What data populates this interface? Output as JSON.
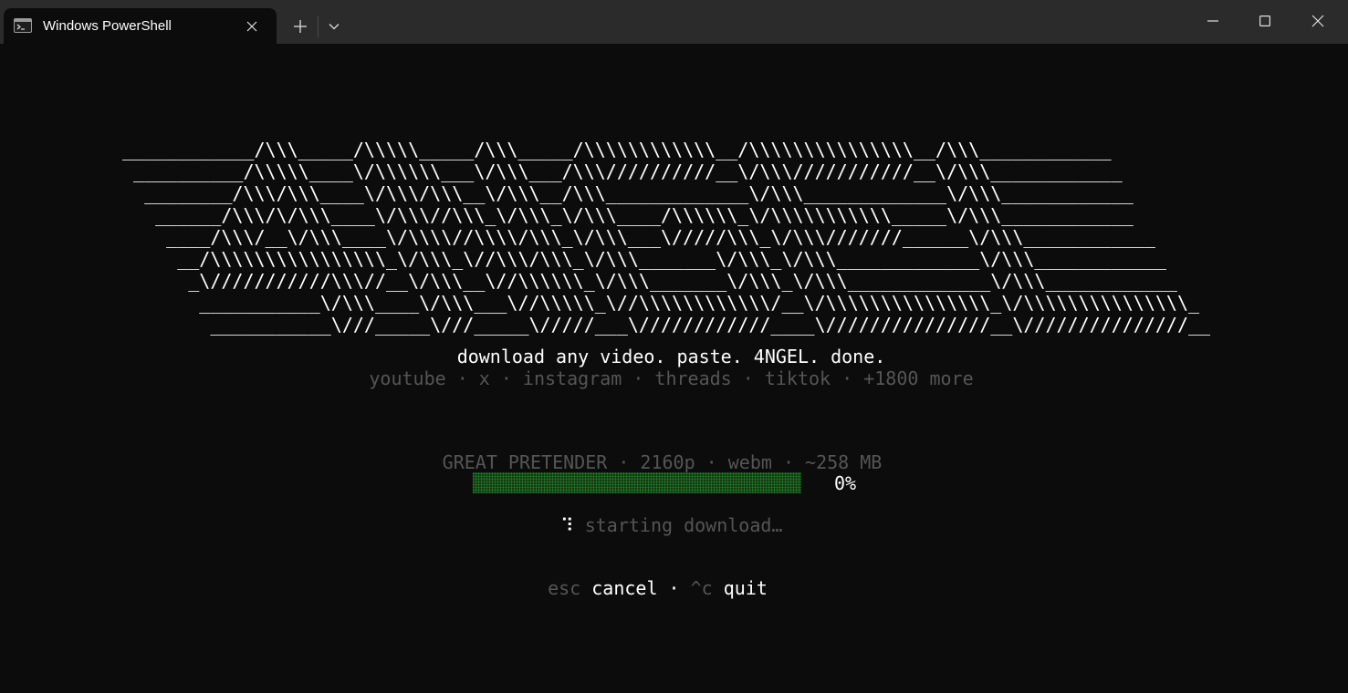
{
  "window": {
    "tab_title": "Windows PowerShell",
    "icons": {
      "tab": "terminal-icon",
      "tab_close": "close-icon",
      "new_tab": "plus-icon",
      "dropdown": "chevron-down-icon",
      "minimize": "minimize-icon",
      "maximize": "maximize-icon",
      "close": "close-icon"
    }
  },
  "terminal": {
    "banner_lines": [
      "____________/\\\\\\_____/\\\\\\\\\\_____/\\\\\\_____/\\\\\\\\\\\\\\\\\\\\\\\\__/\\\\\\\\\\\\\\\\\\\\\\\\\\\\\\__/\\\\\\____________",
      " __________/\\\\\\\\\\____\\/\\\\\\\\\\\\___\\/\\\\\\___/\\\\\\//////////__\\/\\\\\\///////////__\\/\\\\\\____________",
      "  ________/\\\\\\/\\\\\\____\\/\\\\\\/\\\\\\__\\/\\\\\\__/\\\\\\_____________\\/\\\\\\_____________\\/\\\\\\____________",
      "   ______/\\\\\\/\\/\\\\\\____\\/\\\\\\//\\\\\\_\\/\\\\\\_\\/\\\\\\____/\\\\\\\\\\\\_\\/\\\\\\\\\\\\\\\\\\\\\\_____\\/\\\\\\____________",
      "    ____/\\\\\\/__\\/\\\\\\____\\/\\\\\\\\//\\\\\\\\/\\\\\\_\\/\\\\\\___\\/////\\\\\\_\\/\\\\\\///////______\\/\\\\\\____________",
      "     __/\\\\\\\\\\\\\\\\\\\\\\\\\\\\\\\\_\\/\\\\\\_\\//\\\\\\/\\\\\\_\\/\\\\\\_______\\/\\\\\\_\\/\\\\\\_____________\\/\\\\\\____________",
      "      _\\///////////\\\\\\//__\\/\\\\\\__\\//\\\\\\\\\\\\_\\/\\\\\\_______\\/\\\\\\_\\/\\\\\\_____________\\/\\\\\\____________",
      "       ___________\\/\\\\\\____\\/\\\\\\___\\//\\\\\\\\\\_\\//\\\\\\\\\\\\\\\\\\\\\\\\/__\\/\\\\\\\\\\\\\\\\\\\\\\\\\\\\\\_\\/\\\\\\\\\\\\\\\\\\\\\\\\\\\\\\_",
      "        ___________\\///_____\\///_____\\/////___\\////////////____\\///////////////__\\///////////////__"
    ],
    "tagline": "download any video. paste. 4NGEL. done.",
    "supported_sites": "youtube · x · instagram · threads · tiktok · +1800 more",
    "file_info": "GREAT PRETENDER · 2160p · webm · ~258 MB",
    "progress": {
      "fraction": 0,
      "label": "0%",
      "color_track": "#0f3a12",
      "color_fill": "#1fa32a"
    },
    "status": {
      "spinner": "⠹",
      "text": "starting download…"
    },
    "keys": {
      "esc_key": "esc",
      "esc_action": "cancel",
      "separator": "·",
      "ctrl_key": "^c",
      "ctrl_action": "quit"
    }
  }
}
